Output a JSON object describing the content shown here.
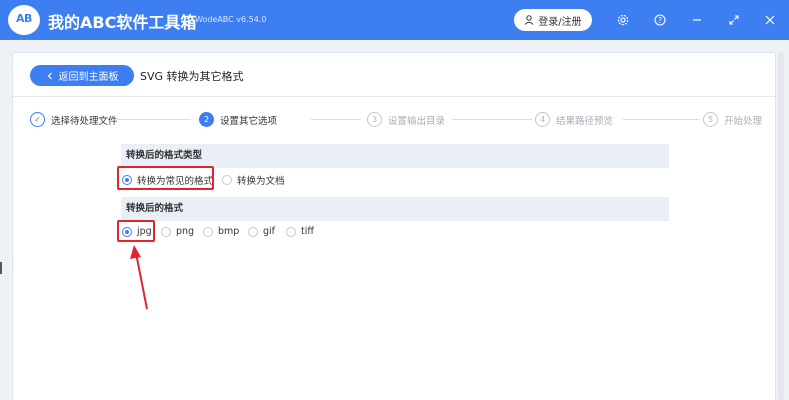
{
  "app": {
    "logo_text": "AB",
    "title": "我的ABC软件工具箱",
    "version": "WodeABC v6.54.0",
    "login_label": "登录/注册",
    "accent_color": "#3d7ef0",
    "icons": [
      "gear-icon",
      "help-icon",
      "minimize-icon",
      "maximize-icon",
      "close-icon"
    ]
  },
  "header": {
    "back_label": "返回到主面板",
    "page_title": "SVG 转换为其它格式"
  },
  "steps": [
    {
      "num": "✓",
      "label": "选择待处理文件",
      "state": "done"
    },
    {
      "num": "2",
      "label": "设置其它选项",
      "state": "active"
    },
    {
      "num": "3",
      "label": "设置输出目录",
      "state": "pending"
    },
    {
      "num": "4",
      "label": "结果路径预览",
      "state": "pending"
    },
    {
      "num": "5",
      "label": "开始处理",
      "state": "pending"
    }
  ],
  "convert_type": {
    "heading": "转换后的格式类型",
    "options": [
      {
        "label": "转换为常见的格式",
        "selected": true
      },
      {
        "label": "转换为文档",
        "selected": false
      }
    ]
  },
  "format": {
    "heading": "转换后的格式",
    "options": [
      {
        "label": "jpg",
        "selected": true
      },
      {
        "label": "png",
        "selected": false
      },
      {
        "label": "bmp",
        "selected": false
      },
      {
        "label": "gif",
        "selected": false
      },
      {
        "label": "tiff",
        "selected": false
      }
    ]
  },
  "annotation_color": "#e0262b"
}
